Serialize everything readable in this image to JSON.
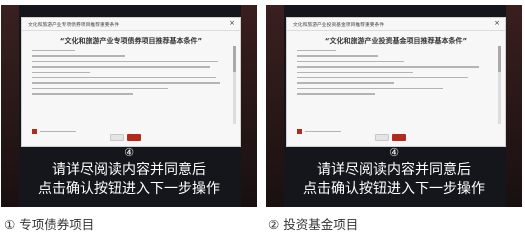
{
  "panels": [
    {
      "dialog_title": "文化和旅游产业专项债券项目推荐重要条件",
      "close_glyph": "×",
      "heading": "“文化和旅游产业专项债券项目推荐基本条件”",
      "step": "④",
      "instruction_line1": "请详尽阅读内容并同意后",
      "instruction_line2": "点击确认按钮进入下一步操作",
      "caption_number": "①",
      "caption_text": "专项债券项目"
    },
    {
      "dialog_title": "文化和旅游产业投资基金项目推荐重要条件",
      "close_glyph": "×",
      "heading": "“文化和旅游产业投资基金项目推荐基本条件”",
      "step": "④",
      "instruction_line1": "请详尽阅读内容并同意后",
      "instruction_line2": "点击确认按钮进入下一步操作",
      "caption_number": "②",
      "caption_text": "投资基金项目"
    }
  ],
  "colors": {
    "panel_bg": "#15151c",
    "accent_red": "#b22a1e",
    "dialog_bg": "#f7f7f7"
  }
}
